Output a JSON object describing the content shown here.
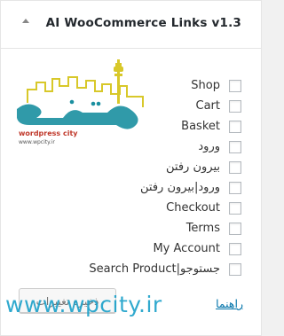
{
  "widget": {
    "title": "AI WooCommerce Links v1.3"
  },
  "logo": {
    "brand_text": "wordpress city",
    "url_text": "www.wpcity.ir"
  },
  "items": [
    {
      "label": "Shop"
    },
    {
      "label": "Cart"
    },
    {
      "label": "Basket"
    },
    {
      "label": "ورود"
    },
    {
      "label": "بیرون رفتن"
    },
    {
      "label": "ورود|بیرون رفتن"
    },
    {
      "label": "Checkout"
    },
    {
      "label": "Terms"
    },
    {
      "label": "My Account"
    },
    {
      "label": "Search Product|جستوجو"
    }
  ],
  "footer": {
    "save_label": "ذخیره تغییرات",
    "help_label": "راهنما"
  },
  "watermark": {
    "text": "www.wpcity.ir"
  },
  "colors": {
    "link": "#0073aa",
    "watermark": "#1aa0c9",
    "logo_teal": "#1a8fa0",
    "logo_yellow": "#d8c82a"
  }
}
